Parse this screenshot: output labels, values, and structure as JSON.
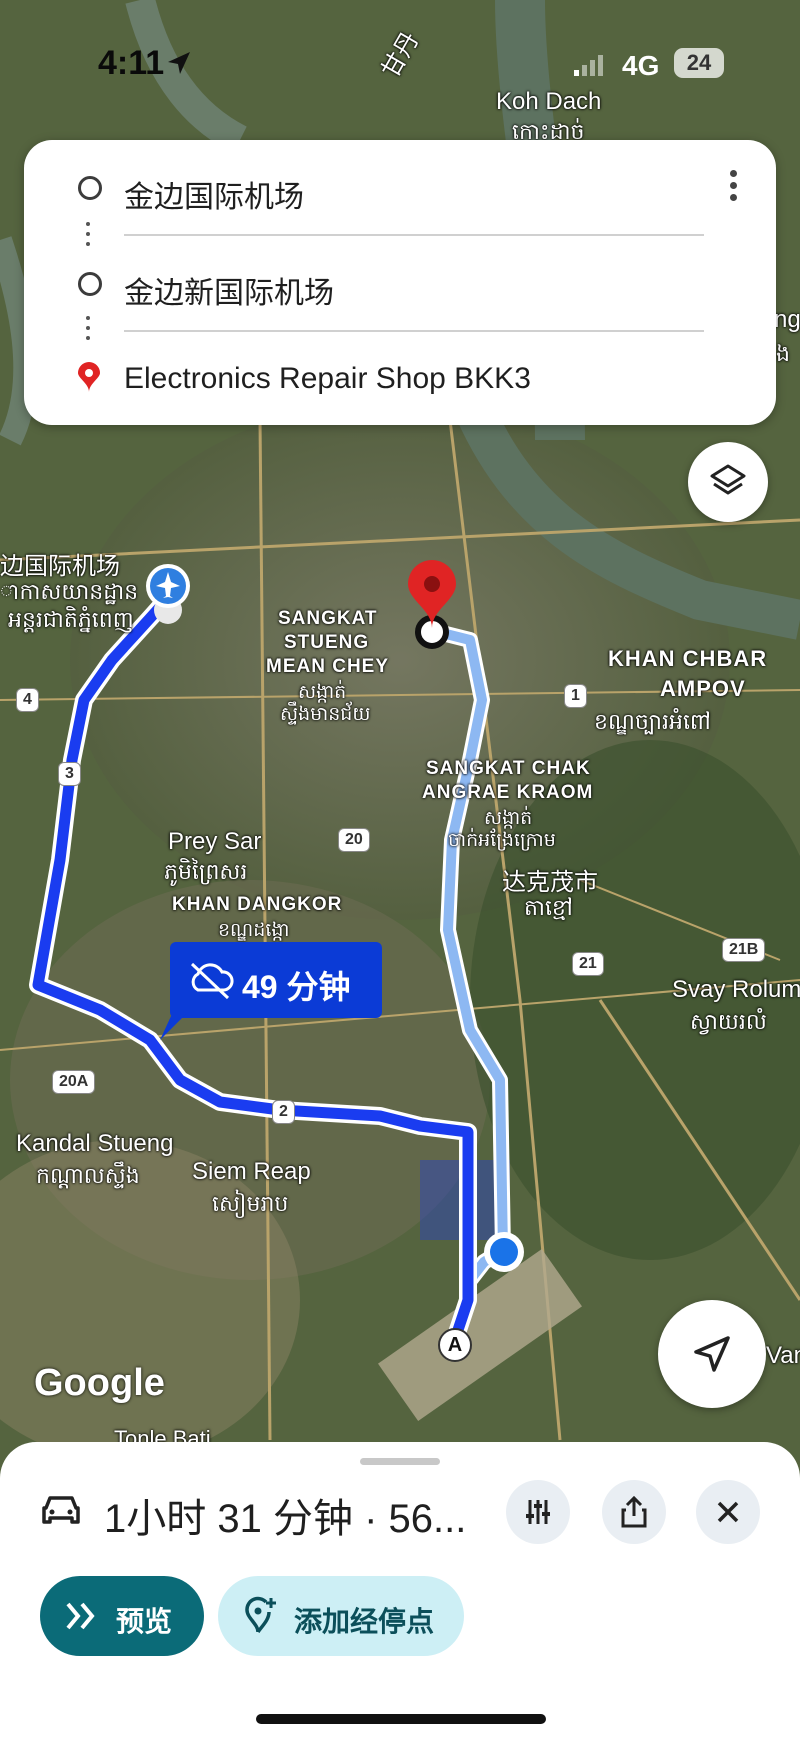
{
  "status_bar": {
    "time": "4:11",
    "network": "4G",
    "battery": "24"
  },
  "route": {
    "stops": [
      {
        "label": "金边国际机场"
      },
      {
        "label": "金边新国际机场"
      },
      {
        "label": "Electronics Repair Shop BKK3"
      }
    ]
  },
  "map": {
    "labels": {
      "koh_dach": "Koh Dach",
      "koh_dach_km": "កោះដាច់",
      "gan": "甘丹",
      "airport_cn": "边国际机场",
      "airport_km1": "ាកាសយានដ្ឋាន",
      "airport_km2": "អន្តរជាតិភ្នំពេញ",
      "stueng1": "SANGKAT",
      "stueng2": "STUENG",
      "stueng3": "MEAN CHEY",
      "stueng_km1": "សង្កាត់",
      "stueng_km2": "ស្ទឹងមានជ័យ",
      "chbar1": "KHAN CHBAR",
      "chbar2": "AMPOV",
      "chbar_km": "ខណ្ឌច្បារអំពៅ",
      "chak1": "SANGKAT CHAK",
      "chak2": "ANGRAE KRAOM",
      "chak_km1": "សង្កាត់",
      "chak_km2": "ចាក់អង្រែក្រោម",
      "preysar": "Prey Sar",
      "preysar_km": "ភូមិព្រៃសរ",
      "dangkor": "KHAN DANGKOR",
      "dangkor_km": "ខណ្ឌដង្កោ",
      "takhmao_cn": "达克茂市",
      "takhmao_km": "តាខ្មៅ",
      "svay": "Svay Rolum",
      "svay_km": "ស្វាយរលំ",
      "kandal": "Kandal Stueng",
      "kandal_km": "កណ្ដាលស្ទឹង",
      "siemreap": "Siem Reap",
      "siemreap_km": "សៀមរាប",
      "tonle": "Tonle Bati",
      "right_edge1": "ng",
      "right_edge2": "ង",
      "right_edge3": "Van"
    },
    "shields": {
      "r4": "4",
      "r3": "3",
      "r20": "20",
      "r1": "1",
      "r21": "21",
      "r21b": "21B",
      "r20a": "20A",
      "r2": "2"
    },
    "waypoint_a": "A",
    "route_time": "49 分钟",
    "google": "Google"
  },
  "sheet": {
    "duration": "1小时 31 分钟 · 56...",
    "preview_label": "预览",
    "add_stop_label": "添加经停点"
  },
  "colors": {
    "route_primary": "#1a3cf0",
    "route_alt": "#8db8f2",
    "pin": "#e02424",
    "accent": "#0b6b78"
  }
}
